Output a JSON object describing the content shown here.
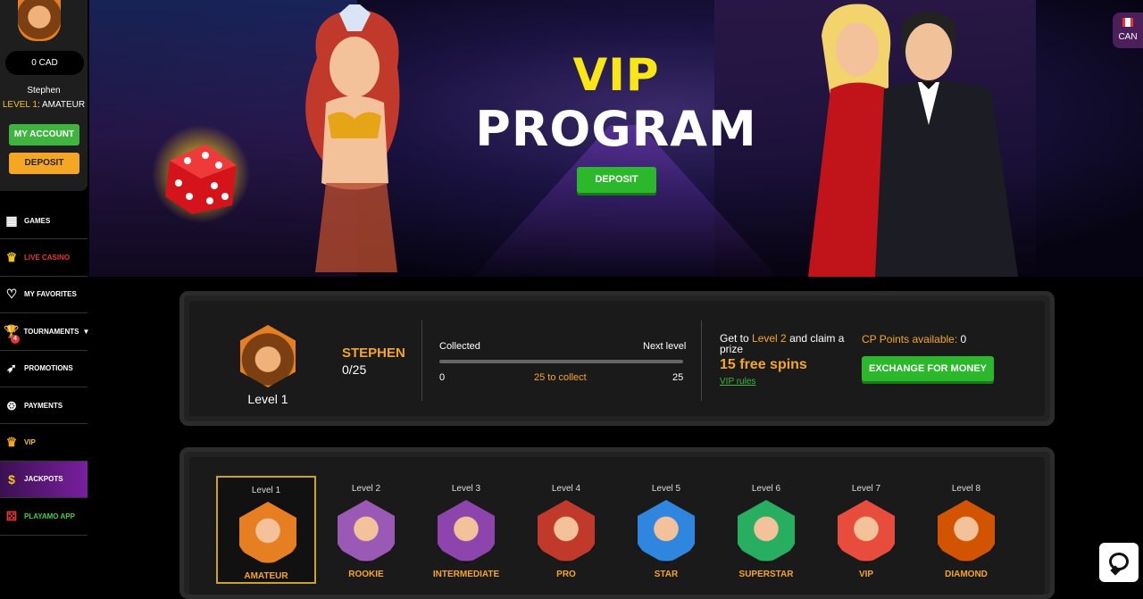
{
  "sidebar": {
    "balance": "0 CAD",
    "player_name": "Stephen",
    "level_label": "LEVEL 1",
    "level_name": ": AMATEUR",
    "my_account": "MY ACCOUNT",
    "deposit": "DEPOSIT",
    "nav": [
      {
        "label": "GAMES",
        "icon": "games-icon"
      },
      {
        "label": "LIVE CASINO",
        "icon": "live-casino-icon"
      },
      {
        "label": "MY FAVORITES",
        "icon": "heart-icon"
      },
      {
        "label": "TOURNAMENTS",
        "icon": "trophy-icon",
        "badge": "4"
      },
      {
        "label": "PROMOTIONS",
        "icon": "rocket-icon"
      },
      {
        "label": "PAYMENTS",
        "icon": "payments-icon"
      },
      {
        "label": "VIP",
        "icon": "crown-icon"
      },
      {
        "label": "JACKPOTS",
        "icon": "money-bag-icon"
      },
      {
        "label": "PLAYAMO APP",
        "icon": "dice-icon"
      }
    ]
  },
  "hero": {
    "title_line1": "VIP",
    "title_line2": "PROGRAM",
    "deposit": "DEPOSIT",
    "currency": "CAN"
  },
  "progress": {
    "level": "Level 1",
    "name": "STEPHEN",
    "points": "0/25",
    "collected_label": "Collected",
    "next_level_label": "Next level",
    "start": "0",
    "to_collect": "25 to collect",
    "end": "25",
    "progress_fraction": 0,
    "get_to": "Get to ",
    "next_level": "Level 2",
    "claim": " and claim a prize",
    "prize": "15 free spins",
    "vip_rules": "VIP rules",
    "cp_label": "CP Points available:",
    "cp_value": " 0",
    "exchange": "EXCHANGE FOR MONEY"
  },
  "levels": [
    {
      "num": "Level 1",
      "name": "AMATEUR",
      "color": "#e67e22",
      "active": true
    },
    {
      "num": "Level 2",
      "name": "ROOKIE",
      "color": "#9b59b6"
    },
    {
      "num": "Level 3",
      "name": "INTERMEDIATE",
      "color": "#8e44ad"
    },
    {
      "num": "Level 4",
      "name": "PRO",
      "color": "#c0392b"
    },
    {
      "num": "Level 5",
      "name": "STAR",
      "color": "#2e86de"
    },
    {
      "num": "Level 6",
      "name": "SUPERSTAR",
      "color": "#27ae60"
    },
    {
      "num": "Level 7",
      "name": "VIP",
      "color": "#e74c3c"
    },
    {
      "num": "Level 8",
      "name": "DIAMOND",
      "color": "#d35400"
    }
  ]
}
